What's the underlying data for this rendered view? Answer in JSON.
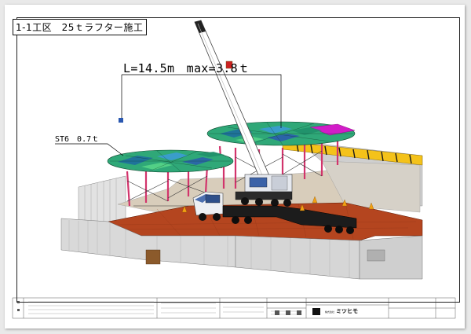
{
  "drawing": {
    "title": "1-1工区　25ｔラフター施工",
    "boom_label": "L=14.5m　max=3.8ｔ",
    "load_label": "ST6　0.7ｔ"
  },
  "colors": {
    "panel": "#2fa878",
    "panel_magenta": "#d21cc8",
    "panel_blue": "#2a58b0",
    "support": "#d2346c",
    "deck": "#b4451f",
    "hoarding": "#d9d9d9",
    "barrier": "#f4c21a",
    "crane_boom": "#ffffff",
    "crane_cab": "#eef0f4",
    "trailer": "#1c1c1c"
  },
  "title_block": {
    "company": "株式会社",
    "logo": "ミツヒモ"
  }
}
